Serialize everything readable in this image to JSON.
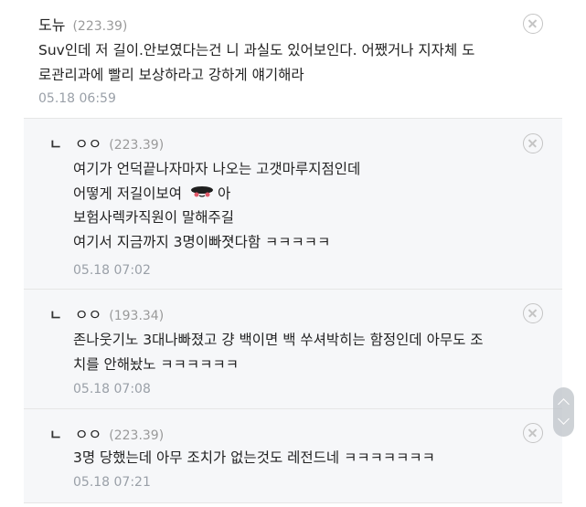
{
  "comments": [
    {
      "nick": "도뉴",
      "ip": "(223.39)",
      "lines": [
        "Suv인데 저 길이.안보였다는건 니 과실도 있어보인다. 어쨌거나 지자체 도",
        "로관리과에 빨리 보상하라고 강하게 얘기해라"
      ],
      "time": "05.18 06:59",
      "is_reply": false
    },
    {
      "reply_mark": "ㄴ",
      "nick": "ㅇㅇ",
      "ip": "(223.39)",
      "lines": [
        "여기가 언덕끝나자마자 나오는 고갯마루지점인데",
        "어떻게 저길이보여",
        "보험사렉카직원이 말해주길",
        "여기서 지금까지 3명이빠졋다함 ㅋㅋㅋㅋㅋ"
      ],
      "inline_after_line_2": "아",
      "time": "05.18 07:02",
      "is_reply": true
    },
    {
      "reply_mark": "ㄴ",
      "nick": "ㅇㅇ",
      "ip": "(193.34)",
      "lines": [
        "존나웃기노 3대나빠졌고 걍 백이면 백 쑤셔박히는 함정인데 아무도 조",
        "치를 안해놨노 ㅋㅋㅋㅋㅋㅋ"
      ],
      "time": "05.18 07:08",
      "is_reply": true
    },
    {
      "reply_mark": "ㄴ",
      "nick": "ㅇㅇ",
      "ip": "(223.39)",
      "lines": [
        "3명 당했는데 아무 조치가 없는것도 레전드네 ㅋㅋㅋㅋㅋㅋㅋ"
      ],
      "time": "05.18 07:21",
      "is_reply": true
    }
  ],
  "icons": {
    "close": "circle-x-icon",
    "emoji": "blushing-face-emoji-icon",
    "scroll_up": "chevron-up-icon",
    "scroll_down": "chevron-down-icon"
  },
  "colors": {
    "reply_background": "#f6f7f9",
    "ip_text": "#9a9a9a",
    "time_text": "#9aa0a8"
  }
}
